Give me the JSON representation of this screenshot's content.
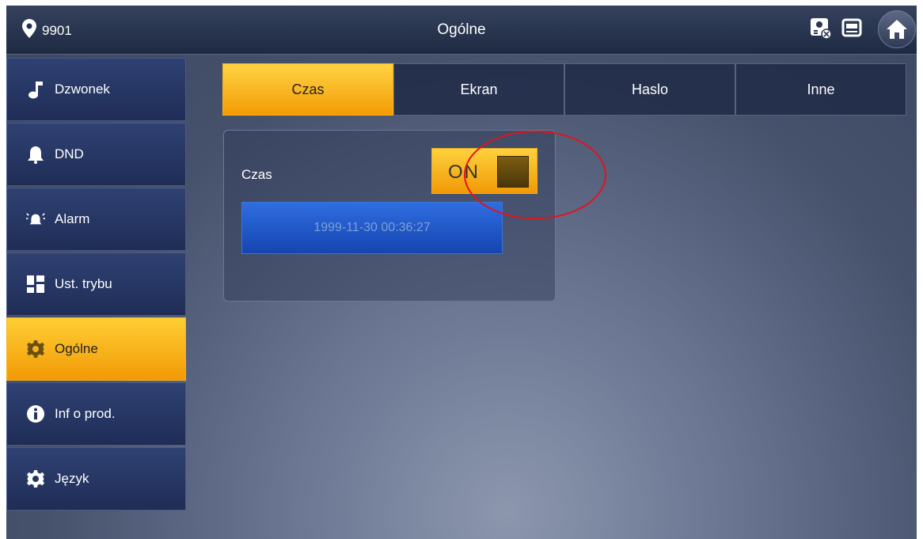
{
  "topbar": {
    "location": "9901",
    "title": "Ogólne"
  },
  "sidebar": {
    "items": [
      {
        "label": "Dzwonek",
        "icon": "music-note-icon"
      },
      {
        "label": "DND",
        "icon": "bell-icon"
      },
      {
        "label": "Alarm",
        "icon": "alarm-icon"
      },
      {
        "label": "Ust. trybu",
        "icon": "grid-icon"
      },
      {
        "label": "Ogólne",
        "icon": "gear-icon",
        "active": true
      },
      {
        "label": "Inf o prod.",
        "icon": "info-icon"
      },
      {
        "label": "Język",
        "icon": "gear-icon"
      }
    ]
  },
  "tabs": [
    {
      "label": "Czas",
      "active": true
    },
    {
      "label": "Ekran"
    },
    {
      "label": "Haslo"
    },
    {
      "label": "Inne"
    }
  ],
  "panel": {
    "label": "Czas",
    "toggle_text": "ON",
    "toggle_state": true,
    "datetime": "1999-11-30 00:36:27"
  },
  "colors": {
    "accent": "#f5a80f",
    "annotation": "#e0141c"
  }
}
